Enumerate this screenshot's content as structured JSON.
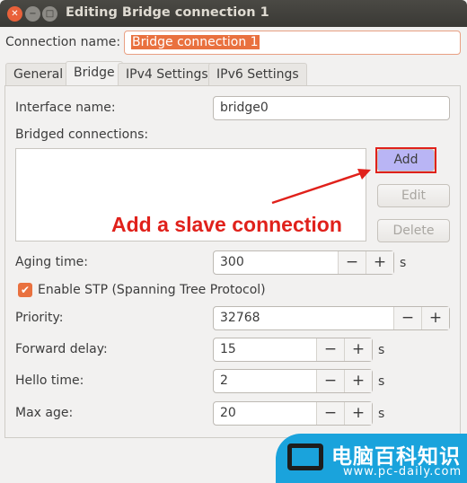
{
  "window": {
    "title": "Editing Bridge connection 1"
  },
  "connection_name": {
    "label": "Connection name:",
    "value": "Bridge connection 1"
  },
  "tabs": [
    {
      "label": "General"
    },
    {
      "label": "Bridge"
    },
    {
      "label": "IPv4 Settings"
    },
    {
      "label": "IPv6 Settings"
    }
  ],
  "active_tab": "Bridge",
  "bridge": {
    "interface_label": "Interface name:",
    "interface_value": "bridge0",
    "bridged_label": "Bridged connections:",
    "add": "Add",
    "edit": "Edit",
    "delete": "Delete",
    "aging_label": "Aging time:",
    "aging_value": "300",
    "stp_label": "Enable STP (Spanning Tree Protocol)",
    "stp_checked": true,
    "priority_label": "Priority:",
    "priority_value": "32768",
    "forward_label": "Forward delay:",
    "forward_value": "15",
    "hello_label": "Hello time:",
    "hello_value": "2",
    "maxage_label": "Max age:",
    "maxage_value": "20",
    "unit": "s",
    "minus": "−",
    "plus": "+"
  },
  "annotation": {
    "text": "Add a slave connection",
    "color": "#e0211b"
  },
  "watermark": {
    "brand": "电脑百科知识",
    "url": "www.pc-daily.com"
  },
  "colors": {
    "accent": "#e9713f",
    "titlebar": "#3c3b37"
  }
}
